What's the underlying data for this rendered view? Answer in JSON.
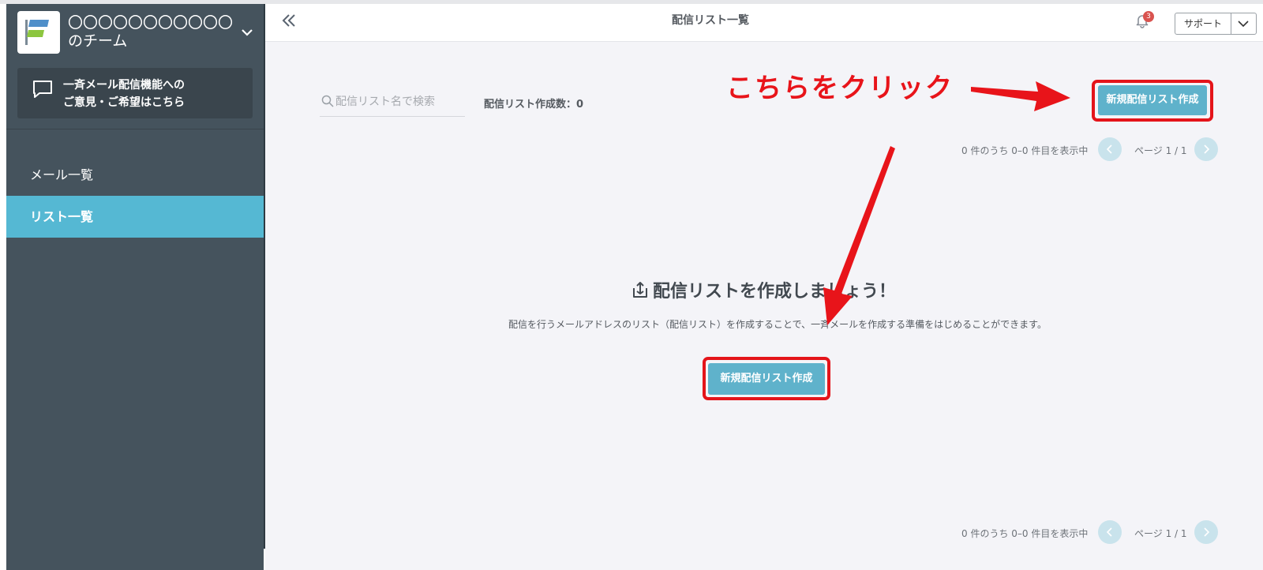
{
  "sidebar": {
    "team_name_line1": "〇〇〇〇〇〇〇〇〇〇〇",
    "team_name_line2": "のチーム",
    "feedback_line1": "一斉メール配信機能への",
    "feedback_line2": "ご意見・ご希望はこちら",
    "items": [
      {
        "label": "メール一覧",
        "active": false
      },
      {
        "label": "リスト一覧",
        "active": true
      }
    ]
  },
  "header": {
    "title": "配信リスト一覧",
    "notification_count": "3",
    "support_label": "サポート"
  },
  "toolbar": {
    "search_placeholder": "配信リスト名で検索",
    "list_count": "配信リスト作成数：0",
    "create_button_label": "新規配信リスト作成"
  },
  "annotation": {
    "text": "こちらをクリック"
  },
  "pagination": {
    "info": "0 件のうち 0–0 件目を表示中",
    "page": "ページ 1 / 1"
  },
  "empty_state": {
    "heading": "配信リストを作成しましょう！",
    "description": "配信を行うメールアドレスのリスト（配信リスト）を作成することで、一斉メールを作成する準備をはじめることができます。",
    "button_label": "新規配信リスト作成"
  },
  "colors": {
    "sidebar_bg": "#45535d",
    "active_nav": "#55b8d3",
    "primary_button": "#5fb2cb",
    "annotation_red": "#e8141a",
    "badge": "#d9534f"
  }
}
